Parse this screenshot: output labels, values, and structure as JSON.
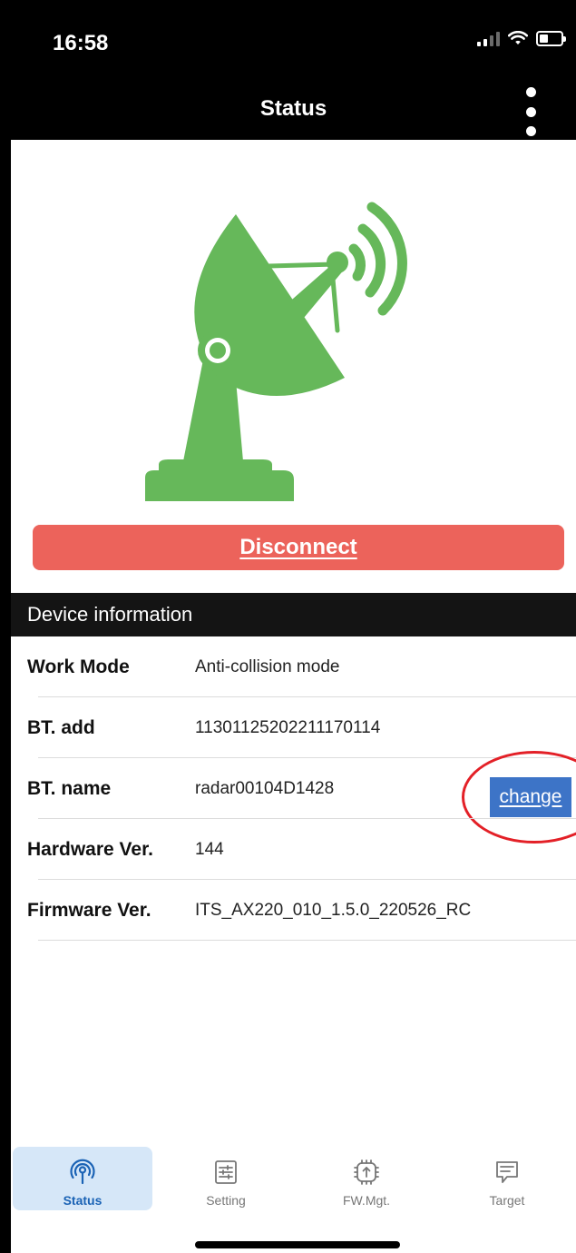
{
  "status_bar": {
    "time": "16:58"
  },
  "header": {
    "title": "Status"
  },
  "colors": {
    "accent": "#5cb85c",
    "danger": "#ec635b",
    "link_blue": "#3d74c7",
    "tab_active_bg": "#d6e7f8"
  },
  "main": {
    "disconnect_label": "Disconnect",
    "section_title": "Device information",
    "rows": [
      {
        "label": "Work Mode",
        "value": "Anti-collision mode"
      },
      {
        "label": "BT. add",
        "value": "11301125202211170114"
      },
      {
        "label": "BT. name",
        "value": "radar00104D1428",
        "action": "change"
      },
      {
        "label": "Hardware Ver.",
        "value": "144"
      },
      {
        "label": "Firmware Ver.",
        "value": "ITS_AX220_010_1.5.0_220526_RC"
      }
    ]
  },
  "tabs": [
    {
      "label": "Status",
      "icon": "radar-signal-icon",
      "active": true
    },
    {
      "label": "Setting",
      "icon": "sliders-icon",
      "active": false
    },
    {
      "label": "FW.Mgt.",
      "icon": "chip-upload-icon",
      "active": false
    },
    {
      "label": "Target",
      "icon": "message-icon",
      "active": false
    }
  ]
}
